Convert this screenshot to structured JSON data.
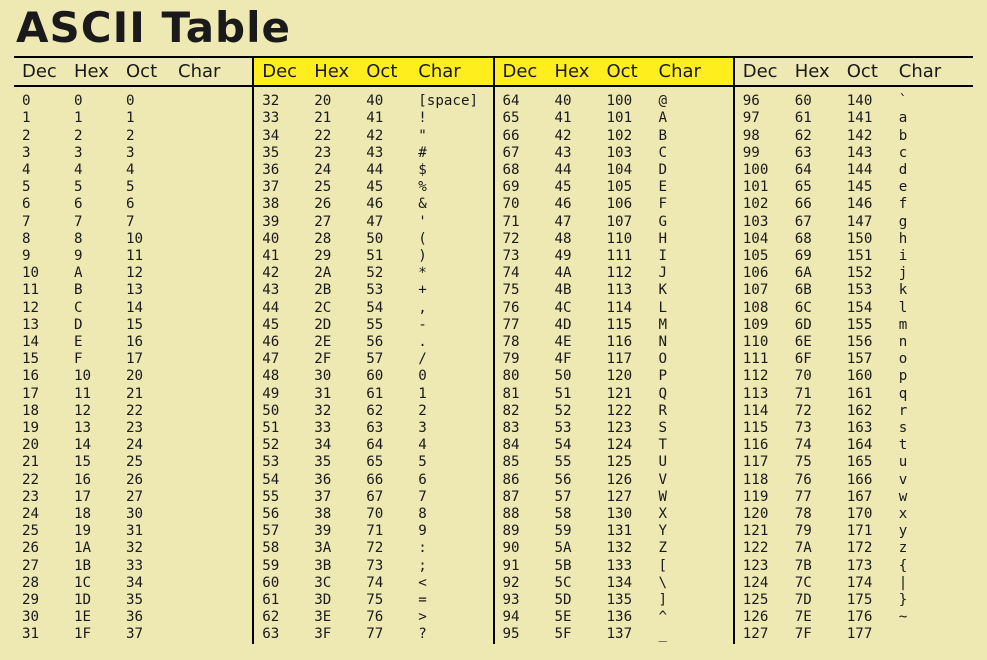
{
  "title": "ASCII Table",
  "headers": {
    "dec": "Dec",
    "hex": "Hex",
    "oct": "Oct",
    "chr": "Char"
  },
  "highlight_cols": [
    1,
    2
  ],
  "chart_data": {
    "type": "table",
    "title": "ASCII Table",
    "columns": [
      "Dec",
      "Hex",
      "Oct",
      "Char"
    ],
    "rows": [
      [
        0,
        "0",
        "0",
        ""
      ],
      [
        1,
        "1",
        "1",
        ""
      ],
      [
        2,
        "2",
        "2",
        ""
      ],
      [
        3,
        "3",
        "3",
        ""
      ],
      [
        4,
        "4",
        "4",
        ""
      ],
      [
        5,
        "5",
        "5",
        ""
      ],
      [
        6,
        "6",
        "6",
        ""
      ],
      [
        7,
        "7",
        "7",
        ""
      ],
      [
        8,
        "8",
        "10",
        ""
      ],
      [
        9,
        "9",
        "11",
        ""
      ],
      [
        10,
        "A",
        "12",
        ""
      ],
      [
        11,
        "B",
        "13",
        ""
      ],
      [
        12,
        "C",
        "14",
        ""
      ],
      [
        13,
        "D",
        "15",
        ""
      ],
      [
        14,
        "E",
        "16",
        ""
      ],
      [
        15,
        "F",
        "17",
        ""
      ],
      [
        16,
        "10",
        "20",
        ""
      ],
      [
        17,
        "11",
        "21",
        ""
      ],
      [
        18,
        "12",
        "22",
        ""
      ],
      [
        19,
        "13",
        "23",
        ""
      ],
      [
        20,
        "14",
        "24",
        ""
      ],
      [
        21,
        "15",
        "25",
        ""
      ],
      [
        22,
        "16",
        "26",
        ""
      ],
      [
        23,
        "17",
        "27",
        ""
      ],
      [
        24,
        "18",
        "30",
        ""
      ],
      [
        25,
        "19",
        "31",
        ""
      ],
      [
        26,
        "1A",
        "32",
        ""
      ],
      [
        27,
        "1B",
        "33",
        ""
      ],
      [
        28,
        "1C",
        "34",
        ""
      ],
      [
        29,
        "1D",
        "35",
        ""
      ],
      [
        30,
        "1E",
        "36",
        ""
      ],
      [
        31,
        "1F",
        "37",
        ""
      ],
      [
        32,
        "20",
        "40",
        "[space]"
      ],
      [
        33,
        "21",
        "41",
        "!"
      ],
      [
        34,
        "22",
        "42",
        "\""
      ],
      [
        35,
        "23",
        "43",
        "#"
      ],
      [
        36,
        "24",
        "44",
        "$"
      ],
      [
        37,
        "25",
        "45",
        "%"
      ],
      [
        38,
        "26",
        "46",
        "&"
      ],
      [
        39,
        "27",
        "47",
        "'"
      ],
      [
        40,
        "28",
        "50",
        "("
      ],
      [
        41,
        "29",
        "51",
        ")"
      ],
      [
        42,
        "2A",
        "52",
        "*"
      ],
      [
        43,
        "2B",
        "53",
        "+"
      ],
      [
        44,
        "2C",
        "54",
        ","
      ],
      [
        45,
        "2D",
        "55",
        "-"
      ],
      [
        46,
        "2E",
        "56",
        "."
      ],
      [
        47,
        "2F",
        "57",
        "/"
      ],
      [
        48,
        "30",
        "60",
        "0"
      ],
      [
        49,
        "31",
        "61",
        "1"
      ],
      [
        50,
        "32",
        "62",
        "2"
      ],
      [
        51,
        "33",
        "63",
        "3"
      ],
      [
        52,
        "34",
        "64",
        "4"
      ],
      [
        53,
        "35",
        "65",
        "5"
      ],
      [
        54,
        "36",
        "66",
        "6"
      ],
      [
        55,
        "37",
        "67",
        "7"
      ],
      [
        56,
        "38",
        "70",
        "8"
      ],
      [
        57,
        "39",
        "71",
        "9"
      ],
      [
        58,
        "3A",
        "72",
        ":"
      ],
      [
        59,
        "3B",
        "73",
        ";"
      ],
      [
        60,
        "3C",
        "74",
        "<"
      ],
      [
        61,
        "3D",
        "75",
        "="
      ],
      [
        62,
        "3E",
        "76",
        ">"
      ],
      [
        63,
        "3F",
        "77",
        "?"
      ],
      [
        64,
        "40",
        "100",
        "@"
      ],
      [
        65,
        "41",
        "101",
        "A"
      ],
      [
        66,
        "42",
        "102",
        "B"
      ],
      [
        67,
        "43",
        "103",
        "C"
      ],
      [
        68,
        "44",
        "104",
        "D"
      ],
      [
        69,
        "45",
        "105",
        "E"
      ],
      [
        70,
        "46",
        "106",
        "F"
      ],
      [
        71,
        "47",
        "107",
        "G"
      ],
      [
        72,
        "48",
        "110",
        "H"
      ],
      [
        73,
        "49",
        "111",
        "I"
      ],
      [
        74,
        "4A",
        "112",
        "J"
      ],
      [
        75,
        "4B",
        "113",
        "K"
      ],
      [
        76,
        "4C",
        "114",
        "L"
      ],
      [
        77,
        "4D",
        "115",
        "M"
      ],
      [
        78,
        "4E",
        "116",
        "N"
      ],
      [
        79,
        "4F",
        "117",
        "O"
      ],
      [
        80,
        "50",
        "120",
        "P"
      ],
      [
        81,
        "51",
        "121",
        "Q"
      ],
      [
        82,
        "52",
        "122",
        "R"
      ],
      [
        83,
        "53",
        "123",
        "S"
      ],
      [
        84,
        "54",
        "124",
        "T"
      ],
      [
        85,
        "55",
        "125",
        "U"
      ],
      [
        86,
        "56",
        "126",
        "V"
      ],
      [
        87,
        "57",
        "127",
        "W"
      ],
      [
        88,
        "58",
        "130",
        "X"
      ],
      [
        89,
        "59",
        "131",
        "Y"
      ],
      [
        90,
        "5A",
        "132",
        "Z"
      ],
      [
        91,
        "5B",
        "133",
        "["
      ],
      [
        92,
        "5C",
        "134",
        "\\"
      ],
      [
        93,
        "5D",
        "135",
        "]"
      ],
      [
        94,
        "5E",
        "136",
        "^"
      ],
      [
        95,
        "5F",
        "137",
        "_"
      ],
      [
        96,
        "60",
        "140",
        "`"
      ],
      [
        97,
        "61",
        "141",
        "a"
      ],
      [
        98,
        "62",
        "142",
        "b"
      ],
      [
        99,
        "63",
        "143",
        "c"
      ],
      [
        100,
        "64",
        "144",
        "d"
      ],
      [
        101,
        "65",
        "145",
        "e"
      ],
      [
        102,
        "66",
        "146",
        "f"
      ],
      [
        103,
        "67",
        "147",
        "g"
      ],
      [
        104,
        "68",
        "150",
        "h"
      ],
      [
        105,
        "69",
        "151",
        "i"
      ],
      [
        106,
        "6A",
        "152",
        "j"
      ],
      [
        107,
        "6B",
        "153",
        "k"
      ],
      [
        108,
        "6C",
        "154",
        "l"
      ],
      [
        109,
        "6D",
        "155",
        "m"
      ],
      [
        110,
        "6E",
        "156",
        "n"
      ],
      [
        111,
        "6F",
        "157",
        "o"
      ],
      [
        112,
        "70",
        "160",
        "p"
      ],
      [
        113,
        "71",
        "161",
        "q"
      ],
      [
        114,
        "72",
        "162",
        "r"
      ],
      [
        115,
        "73",
        "163",
        "s"
      ],
      [
        116,
        "74",
        "164",
        "t"
      ],
      [
        117,
        "75",
        "165",
        "u"
      ],
      [
        118,
        "76",
        "166",
        "v"
      ],
      [
        119,
        "77",
        "167",
        "w"
      ],
      [
        120,
        "78",
        "170",
        "x"
      ],
      [
        121,
        "79",
        "171",
        "y"
      ],
      [
        122,
        "7A",
        "172",
        "z"
      ],
      [
        123,
        "7B",
        "173",
        "{"
      ],
      [
        124,
        "7C",
        "174",
        "|"
      ],
      [
        125,
        "7D",
        "175",
        "}"
      ],
      [
        126,
        "7E",
        "176",
        "~"
      ],
      [
        127,
        "7F",
        "177",
        ""
      ]
    ]
  }
}
